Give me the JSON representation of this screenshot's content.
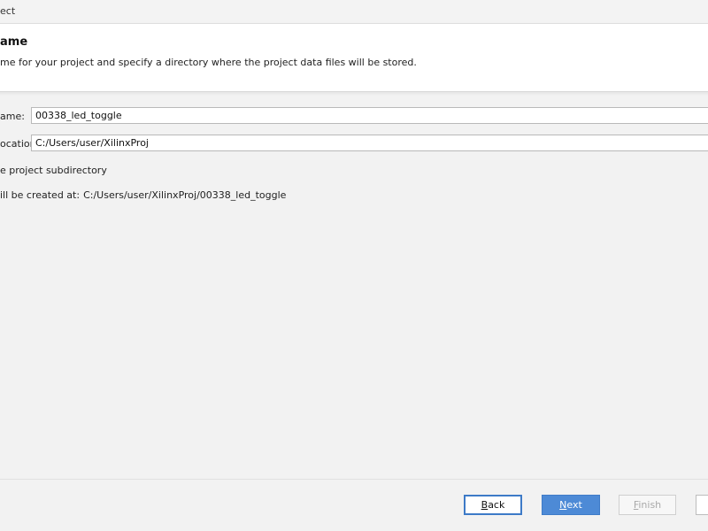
{
  "window": {
    "title": "ect"
  },
  "header": {
    "heading": "ame",
    "description": "me for your project and specify a directory where the project data files will be stored."
  },
  "form": {
    "project_name_label": "ame:",
    "project_name_value": "00338_led_toggle",
    "project_location_label": "ocation:",
    "project_location_value": "C:/Users/user/XilinxProj",
    "subdirectory_label": "e project subdirectory",
    "created_at_label": "ill be created at:",
    "created_at_path": "C:/Users/user/XilinxProj/00338_led_toggle"
  },
  "buttons": {
    "back_label": "Back",
    "next_label": "Next",
    "finish_label": "Finish",
    "cancel_label": ""
  },
  "colors": {
    "accent": "#4d8ad6",
    "focus_border": "#3d7ac7",
    "disabled_text": "#a9a9a9"
  }
}
